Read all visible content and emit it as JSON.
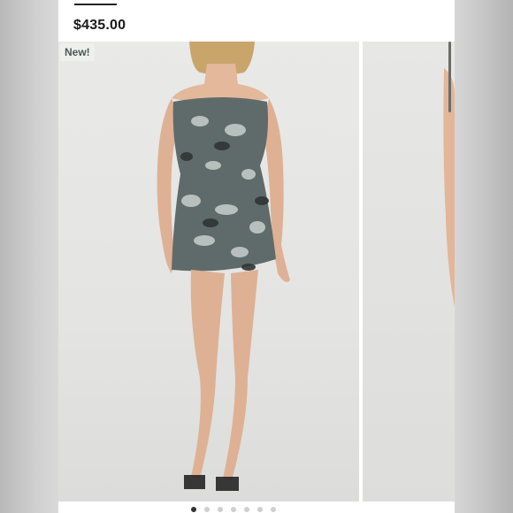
{
  "product": {
    "price": "$435.00",
    "badge": "New!"
  },
  "gallery": {
    "slide_count": 7,
    "active_index": 0
  },
  "colors": {
    "background": "#ffffff",
    "badge_bg": "#eef0ee",
    "badge_text": "#4a5a55",
    "dress": "#5f6b6a"
  }
}
